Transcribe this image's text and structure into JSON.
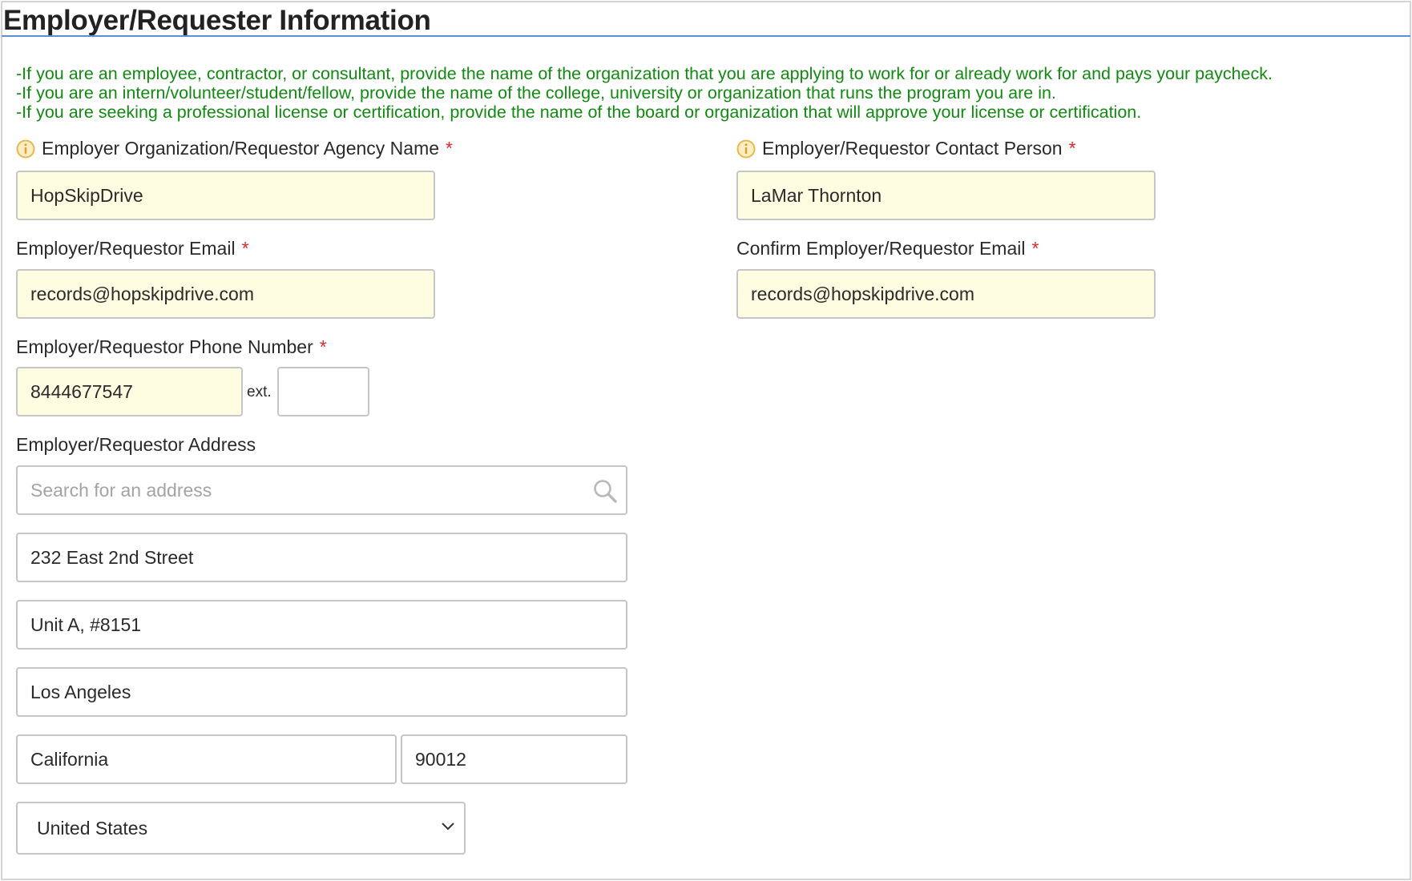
{
  "section": {
    "title": "Employer/Requester Information"
  },
  "instructions": [
    "-If you are an employee, contractor, or consultant, provide the name of the organization that you are applying to work for or already work for and pays your paycheck.",
    "-If you are an intern/volunteer/student/fellow, provide the name of the college, university or organization that runs the program you are in.",
    "-If you are seeking a professional license or certification, provide the name of the board or organization that will approve your license or certification."
  ],
  "required_marker": "*",
  "fields": {
    "agency_name": {
      "label": "Employer Organization/Requestor Agency Name",
      "value": "HopSkipDrive"
    },
    "contact_person": {
      "label": "Employer/Requestor Contact Person",
      "value": "LaMar Thornton"
    },
    "email": {
      "label": "Employer/Requestor Email",
      "value": "records@hopskipdrive.com"
    },
    "confirm_email": {
      "label": "Confirm Employer/Requestor Email",
      "value": "records@hopskipdrive.com"
    },
    "phone": {
      "label": "Employer/Requestor Phone Number",
      "value": "8444677547",
      "ext_label": "ext.",
      "ext_value": ""
    },
    "address": {
      "label": "Employer/Requestor Address",
      "search_placeholder": "Search for an address",
      "street1": "232 East 2nd Street",
      "street2": "Unit A, #8151",
      "city": "Los Angeles",
      "state": "California",
      "zip": "90012",
      "country": "United States"
    }
  },
  "colors": {
    "instruction_text": "#128a12",
    "required": "#e0262b",
    "filled_field_bg": "#fefde2",
    "title_rule": "#5b8fd6",
    "info_icon": "#e7b84a"
  },
  "icons": {
    "info": "info-icon",
    "search": "search-icon",
    "dropdown": "chevron-down-icon"
  }
}
